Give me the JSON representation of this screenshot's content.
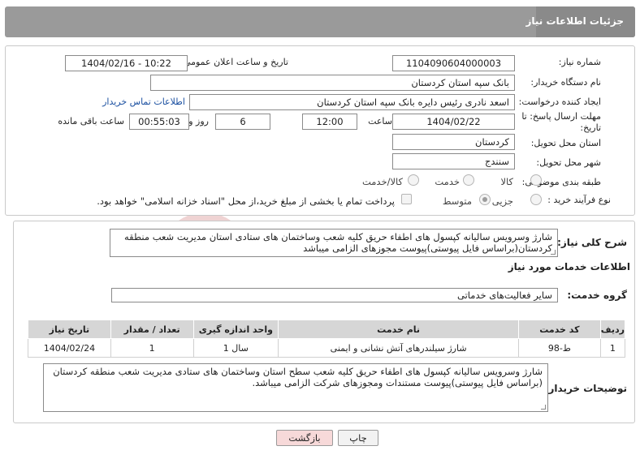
{
  "header": {
    "title": "جزئیات اطلاعات نیاز"
  },
  "fields": {
    "need_number_label": "شماره نیاز:",
    "need_number": "1104090604000003",
    "announce_label": "تاریخ و ساعت اعلان عمومی:",
    "announce_value": "1404/02/16 - 10:22",
    "buyer_org_label": "نام دستگاه خریدار:",
    "buyer_org": "بانک سپه استان کردستان",
    "creator_label": "ایجاد کننده درخواست:",
    "creator": "اسعد نادری رئیس دایره بانک سپه استان کردستان",
    "contact_link": "اطلاعات تماس خریدار",
    "deadline_label_1": "مهلت ارسال پاسخ: تا",
    "deadline_label_2": "تاریخ:",
    "deadline_date": "1404/02/22",
    "time_label": "ساعت",
    "deadline_time": "12:00",
    "days_value": "6",
    "days_label": "روز و",
    "remaining_time": "00:55:03",
    "remaining_label": "ساعت باقی مانده",
    "province_label": "استان محل تحویل:",
    "province": "کردستان",
    "city_label": "شهر محل تحویل:",
    "city": "سنندج",
    "category_label": "طبقه بندی موضوعی:",
    "category_options": [
      "کالا",
      "خدمت",
      "کالا/خدمت"
    ],
    "process_label": "نوع فرآیند خرید :",
    "process_options": [
      "جزیی",
      "متوسط"
    ],
    "payment_note": "پرداخت تمام یا بخشی از مبلغ خرید،از محل \"اسناد خزانه اسلامی\" خواهد بود."
  },
  "summary": {
    "label": "شرح کلی نیاز:",
    "text": "شارژ وسرویس سالیانه کپسول های اطفاء حریق کلیه شعب وساختمان های ستادی استان مدیریت شعب منطقه کردستان(براساس فایل پیوستی)پیوست مجوزهای الزامی میباشد"
  },
  "services": {
    "section_title": "اطلاعات خدمات مورد نیاز",
    "group_label": "گروه خدمت:",
    "group_value": "سایر فعالیت‌های خدماتی",
    "columns": [
      "ردیف",
      "کد خدمت",
      "نام خدمت",
      "واحد اندازه گیری",
      "تعداد / مقدار",
      "تاریخ نیاز"
    ],
    "rows": [
      {
        "row": "1",
        "code": "ط-98",
        "name": "شارژ سیلندرهای آتش نشانی و ایمنی",
        "unit": "1 سال",
        "qty": "1",
        "date": "1404/02/24"
      }
    ]
  },
  "buyer_notes": {
    "label": "توضیحات خریدار:",
    "text": "شارژ وسرویس سالیانه کپسول های اطفاء حریق کلیه شعب سطح استان وساختمان های ستادی مدیریت شعب منطقه کردستان (براساس فایل پیوستی)پیوست مستندات ومجوزهای شرکت الزامی میباشد."
  },
  "buttons": {
    "print": "چاپ",
    "back": "بازگشت"
  },
  "watermark_text": "AriaTender.neT",
  "colors": {
    "header": "#9a9a9a",
    "header_tab": "#8a8a8a",
    "link": "#1a4fa0",
    "back_button": "#f7d9d9",
    "print_button": "#f2f2f2",
    "watermark": "#e7c2c2"
  }
}
